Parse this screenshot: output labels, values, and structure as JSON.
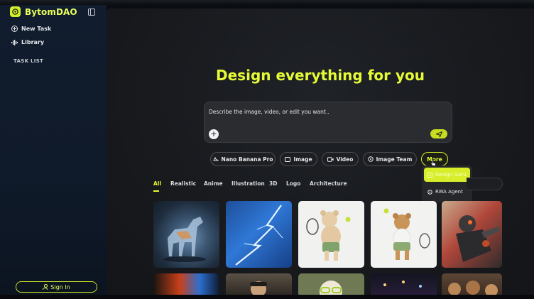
{
  "brand": {
    "name": "BytomDAO"
  },
  "sidebar": {
    "new_task": "New Task",
    "library": "Library",
    "task_list": "TASK LIST",
    "sign_in": "Sign In"
  },
  "main": {
    "headline": "Design everything for you",
    "prompt_placeholder": "Describe the image, video, or edit you want..",
    "attach_label": "+",
    "chips": [
      "Nano Banana Pro",
      "Image",
      "Video",
      "Image Team",
      "More"
    ],
    "more_menu": [
      "Design Guru",
      "RWA Agent"
    ],
    "tabs": [
      "All",
      "Realistic",
      "Anime",
      "Illustration",
      "3D",
      "Logo",
      "Architecture"
    ],
    "active_tab": "All"
  },
  "colors": {
    "accent": "#e6fb35",
    "sidebar_bg": "#111c2e",
    "main_bg": "#1a1c20"
  },
  "gallery": [
    {
      "subject": "crystal-horse"
    },
    {
      "subject": "blue-lightning"
    },
    {
      "subject": "teddy-bear-tennis"
    },
    {
      "subject": "teddy-bear-tennis-2"
    },
    {
      "subject": "robot-warrior"
    },
    {
      "subject": "fiery-scene"
    },
    {
      "subject": "portrait-city"
    },
    {
      "subject": "girl-green-glasses"
    },
    {
      "subject": "night-street"
    },
    {
      "subject": "cookies"
    }
  ]
}
